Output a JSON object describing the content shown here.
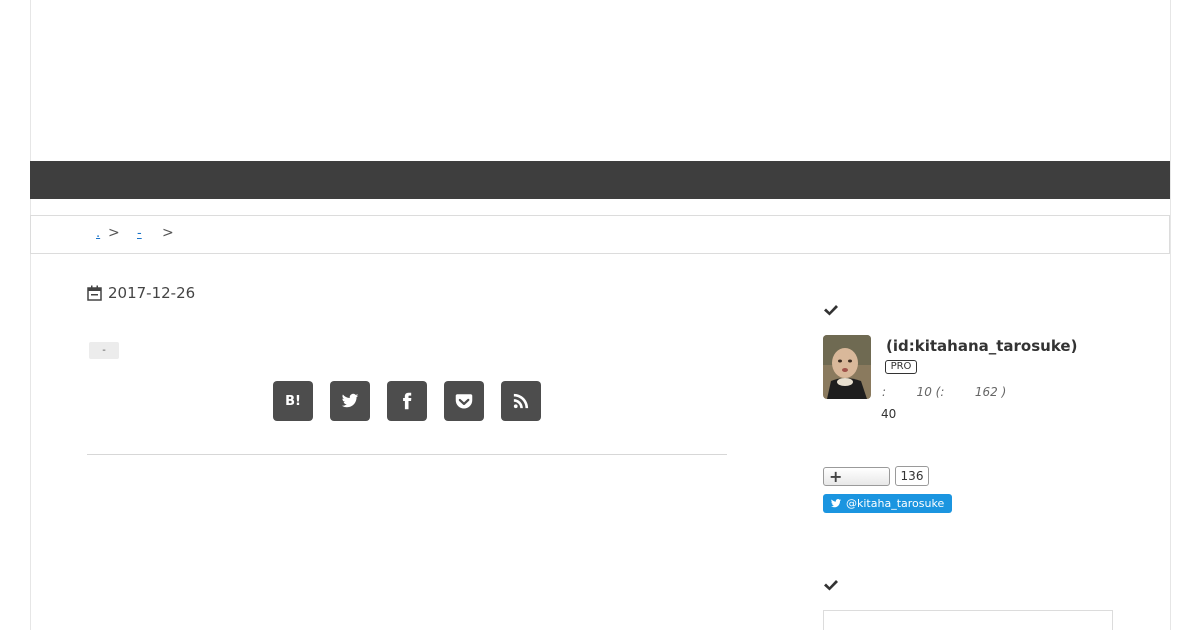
{
  "breadcrumb": {
    "items": [
      ".",
      "-"
    ],
    "separator": ">"
  },
  "article": {
    "date": "2017-12-26",
    "category": "-"
  },
  "share": {
    "buttons": [
      "hatena-bookmark",
      "twitter",
      "facebook",
      "pocket",
      "rss"
    ],
    "hatena_label": "B!"
  },
  "profile": {
    "id": "(id:kitahana_tarosuke)",
    "badge": "PRO",
    "stats_line": ":        10 (:        162 )",
    "stats_sub": "40",
    "follow_count": "136",
    "twitter_handle": "@kitaha_tarosuke"
  },
  "colors": {
    "nav_bar": "#3e3e3e",
    "share_button": "#4d4d4d",
    "twitter": "#1b95e0",
    "link": "#1a73c8"
  }
}
